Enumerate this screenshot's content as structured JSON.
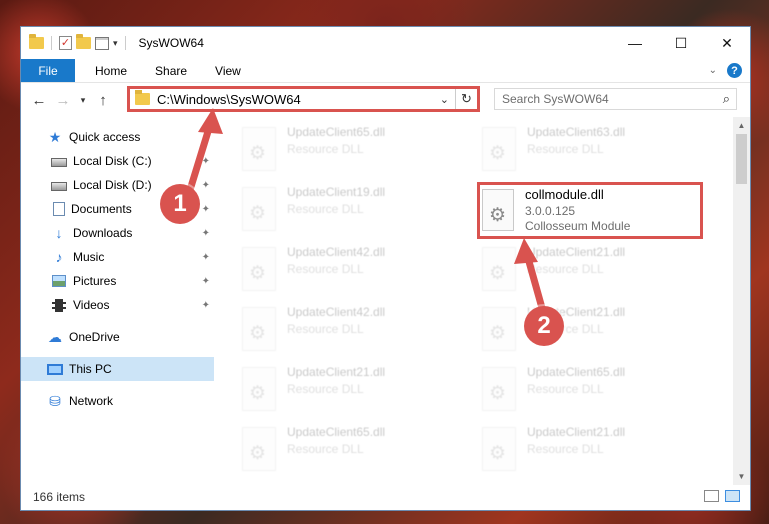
{
  "window": {
    "title": "SysWOW64",
    "controls": {
      "minimize": "—",
      "maximize": "☐",
      "close": "✕"
    }
  },
  "ribbon": {
    "tabs": [
      {
        "label": "File",
        "active": true
      },
      {
        "label": "Home"
      },
      {
        "label": "Share"
      },
      {
        "label": "View"
      }
    ],
    "help": "?"
  },
  "address": {
    "path": "C:\\Windows\\SysWOW64",
    "search_placeholder": "Search SysWOW64"
  },
  "sidebar": {
    "items": [
      {
        "label": "Quick access",
        "icon": "star-icon"
      },
      {
        "label": "Local Disk (C:)",
        "icon": "disk-icon",
        "pinned": true
      },
      {
        "label": "Local Disk (D:)",
        "icon": "disk-icon",
        "pinned": true
      },
      {
        "label": "Documents",
        "icon": "documents-icon",
        "pinned": true
      },
      {
        "label": "Downloads",
        "icon": "download-icon",
        "pinned": true
      },
      {
        "label": "Music",
        "icon": "music-icon",
        "pinned": true
      },
      {
        "label": "Pictures",
        "icon": "pictures-icon",
        "pinned": true
      },
      {
        "label": "Videos",
        "icon": "videos-icon",
        "pinned": true
      },
      {
        "label": "OneDrive",
        "icon": "cloud-icon"
      },
      {
        "label": "This PC",
        "icon": "pc-icon",
        "selected": true
      },
      {
        "label": "Network",
        "icon": "network-icon"
      }
    ]
  },
  "files": {
    "left_column": [
      {
        "name": "UpdateClient65.dll",
        "type": "Resource DLL"
      },
      {
        "name": "UpdateClient19.dll",
        "type": "Resource DLL"
      },
      {
        "name": "UpdateClient42.dll",
        "type": "Resource DLL"
      },
      {
        "name": "UpdateClient42.dll",
        "type": "Resource DLL"
      },
      {
        "name": "UpdateClient21.dll",
        "type": "Resource DLL"
      },
      {
        "name": "UpdateClient65.dll",
        "type": "Resource DLL"
      }
    ],
    "right_column": [
      {
        "name": "UpdateClient63.dll",
        "type": "Resource DLL"
      },
      {
        "name": "UpdateClient21.dll",
        "type": "Resource DLL"
      },
      {
        "name": "UpdateClient21.dll",
        "type": "Resource DLL"
      },
      {
        "name": "UpdateClient65.dll",
        "type": "Resource DLL"
      },
      {
        "name": "UpdateClient21.dll",
        "type": "Resource DLL"
      }
    ],
    "highlighted": {
      "name": "collmodule.dll",
      "version": "3.0.0.125",
      "description": "Collosseum Module"
    }
  },
  "status": {
    "item_count": "166 items"
  },
  "annotations": {
    "step1": "1",
    "step2": "2",
    "color": "#d9534f"
  }
}
